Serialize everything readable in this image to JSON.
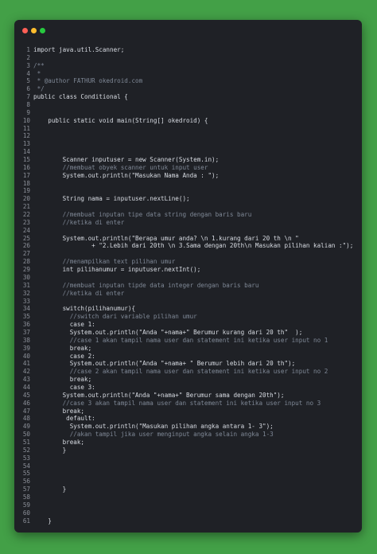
{
  "window": {
    "colors": {
      "background": "#43a047",
      "editor": "#1f2126",
      "dot_close": "#ff5f56",
      "dot_min": "#ffbd2e",
      "dot_max": "#27c93f"
    }
  },
  "code_lines": [
    "import java.util.Scanner;",
    "",
    "/**",
    " *",
    " * @author FATHUR okedroid.com",
    " */",
    "public class Conditional {",
    "",
    "",
    "    public static void main(String[] okedroid) {",
    "",
    "",
    "",
    "",
    "        Scanner inputuser = new Scanner(System.in);",
    "        //membuat obyek scanner untuk input user",
    "        System.out.println(\"Masukan Nama Anda : \");",
    "",
    "",
    "        String nama = inputuser.nextLine();",
    "",
    "        //membuat inputan tipe data string dengan baris baru",
    "        //ketika di enter",
    "",
    "        System.out.println(\"Berapa umur anda? \\n 1.kurang dari 20 th \\n \"",
    "                + \"2.Lebih dari 20th \\n 3.Sama dengan 20th\\n Masukan pilihan kalian :\");",
    "",
    "        //menampilkan text pilihan umur",
    "        int pilihanumur = inputuser.nextInt();",
    "",
    "        //membuat inputan tipde data integer dengan baris baru",
    "        //ketika di enter",
    "",
    "        switch(pilihanumur){",
    "          //switch dari variable pilihan umur",
    "          case 1:",
    "          System.out.println(\"Anda \"+nama+\" Berumur kurang dari 20 th\"  );",
    "          //case 1 akan tampil nama user dan statement ini ketika user input no 1",
    "          break;",
    "          case 2:",
    "          System.out.println(\"Anda \"+nama+ \" Berumur lebih dari 20 th\");",
    "          //case 2 akan tampil nama user dan statement ini ketika user input no 2",
    "          break;",
    "          case 3:",
    "        System.out.println(\"Anda \"+nama+\" Berumur sama dengan 20th\");",
    "        //case 3 akan tampil nama user dan statement ini ketika user input no 3",
    "        break;",
    "         default:",
    "          System.out.println(\"Masukan pilihan angka antara 1- 3\");",
    "          //akan tampil jika user menginput angka selain angka 1-3",
    "        break;",
    "        }",
    "",
    "",
    "",
    "",
    "        }",
    "",
    "",
    "",
    "    }"
  ]
}
